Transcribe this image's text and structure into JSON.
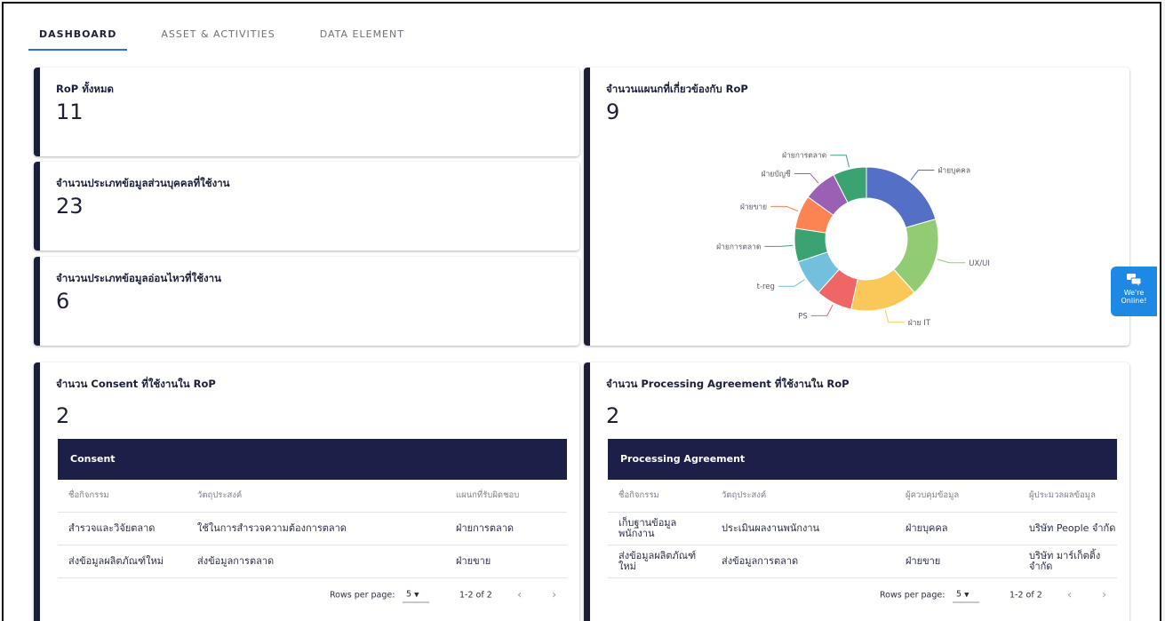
{
  "tabs": [
    {
      "label": "DASHBOARD",
      "active": true
    },
    {
      "label": "ASSET & ACTIVITIES",
      "active": false
    },
    {
      "label": "DATA ELEMENT",
      "active": false
    }
  ],
  "stats": {
    "rop_total": {
      "title": "RoP ทั้งหมด",
      "value": "11"
    },
    "personal_data_types": {
      "title": "จำนวนประเภทข้อมูลส่วนบุคคลที่ใช้งาน",
      "value": "23"
    },
    "sensitive_data_types": {
      "title": "จำนวนประเภทข้อมูลอ่อนไหวที่ใช้งาน",
      "value": "6"
    },
    "departments": {
      "title": "จำนวนแผนกที่เกี่ยวข้องกับ RoP",
      "value": "9"
    }
  },
  "chart_data": {
    "type": "pie",
    "labels": [
      "ฝ่ายบุคคล",
      "UX/UI",
      "ฝ่าย IT",
      "PS",
      "t-reg",
      "ฝ่ายการตลาด",
      "ฝ่ายขาย",
      "ฝ่ายบัญชี",
      "ฝ่ายการตลาด"
    ],
    "values": [
      1.5,
      1.3,
      1.1,
      0.6,
      0.6,
      0.55,
      0.55,
      0.55,
      0.55
    ],
    "colors": [
      "#5470c6",
      "#91cc75",
      "#fac858",
      "#ee6666",
      "#73c0de",
      "#3ba272",
      "#fc8452",
      "#9a60b4",
      "#3ba272"
    ],
    "donut": true
  },
  "consent": {
    "title": "จำนวน Consent ที่ใช้งานใน RoP",
    "value": "2",
    "header": "Consent",
    "columns": [
      "ชื่อกิจกรรม",
      "วัตถุประสงค์",
      "แผนกที่รับผิดชอบ"
    ],
    "rows": [
      [
        "สำรวจและวิจัยตลาด",
        "ใช้ในการสำรวจความต้องการตลาด",
        "ฝ่ายการตลาด"
      ],
      [
        "ส่งข้อมูลผลิตภัณฑ์ใหม่",
        "ส่งข้อมูลการตลาด",
        "ฝ่ายขาย"
      ]
    ],
    "pager": {
      "rows_label": "Rows per page:",
      "rows_value": "5",
      "range": "1-2 of 2"
    }
  },
  "processing": {
    "title": "จำนวน Processing Agreement ที่ใช้งานใน RoP",
    "value": "2",
    "header": "Processing Agreement",
    "columns": [
      "ชื่อกิจกรรม",
      "วัตถุประสงค์",
      "ผู้ควบคุมข้อมูล",
      "ผู้ประมวลผลข้อมูล"
    ],
    "rows": [
      [
        "เก็บฐานข้อมูลพนักงาน",
        "ประเมินผลงานพนักงาน",
        "ฝ่ายบุคคล",
        "บริษัท People จำกัด"
      ],
      [
        "ส่งข้อมูลผลิตภัณฑ์ใหม่",
        "ส่งข้อมูลการตลาด",
        "ฝ่ายขาย",
        "บริษัท มาร์เก็ตติ้ง จำกัด"
      ]
    ],
    "pager": {
      "rows_label": "Rows per page:",
      "rows_value": "5",
      "range": "1-2 of 2"
    }
  },
  "chat": {
    "line1": "We're",
    "line2": "Online!"
  }
}
